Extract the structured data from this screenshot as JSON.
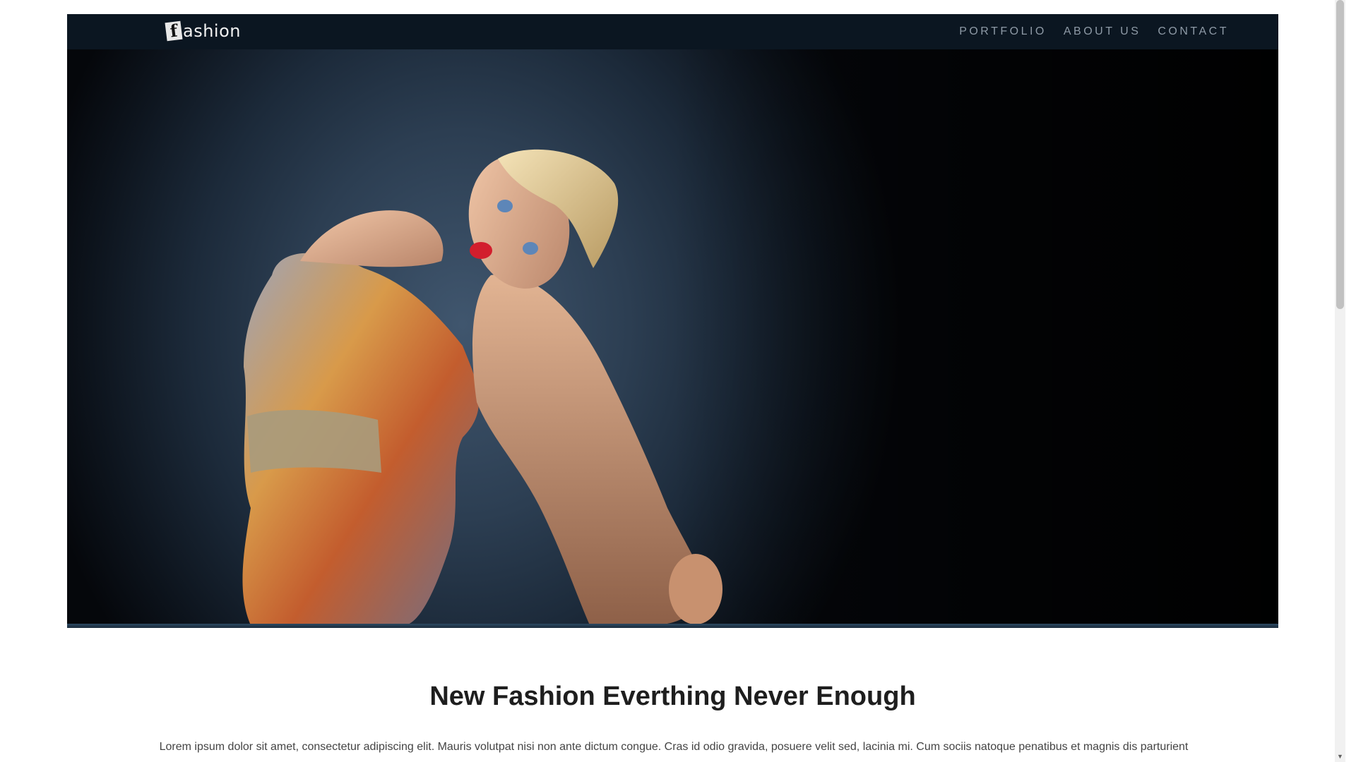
{
  "brand": {
    "logo_initial": "f",
    "logo_rest": "ashion"
  },
  "nav": {
    "items": [
      {
        "label": "PORTFOLIO"
      },
      {
        "label": "ABOUT US"
      },
      {
        "label": "CONTACT"
      }
    ]
  },
  "hero": {
    "image": "model-photo"
  },
  "main": {
    "headline": "New Fashion Everthing Never Enough",
    "body": "Lorem ipsum dolor sit amet, consectetur adipiscing elit. Mauris volutpat nisi non ante dictum congue. Cras id odio gravida, posuere velit sed, lacinia mi. Cum sociis natoque penatibus et magnis dis parturient"
  },
  "colors": {
    "navbar_bg": "#0b1621",
    "nav_text": "#8e9aa6",
    "headline": "#1e1e1e",
    "body_text": "#444444"
  },
  "icons": {
    "scroll_down": "chevron-down-icon"
  }
}
